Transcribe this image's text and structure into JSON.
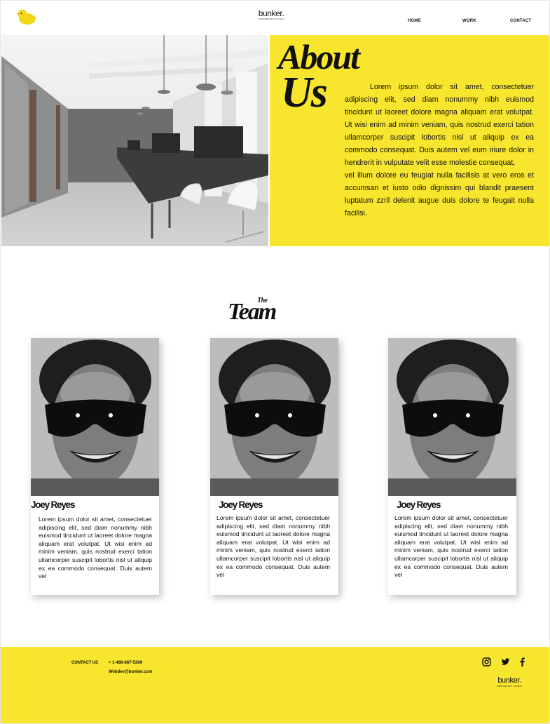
{
  "header": {
    "brand_name": "bunker.",
    "brand_tagline": "WEB DESIGN STUDIO",
    "nav": [
      "HOME",
      "WORK",
      "CONTACT"
    ]
  },
  "about": {
    "title_line1": "About",
    "title_line2": "Us",
    "paragraphs": [
      "Lorem ipsum dolor sit amet, consectetuer adipiscing elit, sed diam nonummy nibh euismod tincidunt ut laoreet dolore magna aliquam erat volutpat. Ut wisi enim ad minim veniam, quis nostrud exerci tation ullamcorper suscipit lobortis nisl ut aliquip ex ea commodo consequat. Duis autem vel eum iriure dolor in hendrerit in vulputate velit esse molestie consequat,",
      "vel illum dolore eu feugiat nulla facilisis at vero eros et accumsan et iusto odio dignissim qui blandit praesent luptatum zzril delenit augue duis dolore te feugait nulla facilisi."
    ]
  },
  "team": {
    "title_small": "The",
    "title_large": "Team",
    "members": [
      {
        "name": "Joey Reyes",
        "bio": "Lorem ipsum dolor sit amet, consectetuer adipiscing elit, sed diam nonummy nibh euismod tincidunt ut laoreet dolore magna aliquam erat volutpat. Ut wisi enim ad minim veniam, quis nostrud exerci tation ullamcorper suscipit lobortis nisl ut aliquip ex ea commodo consequat. Duis autem vel"
      },
      {
        "name": "Joey Reyes",
        "bio": "Lorem ipsum dolor sit amet, consectetuer adipiscing elit, sed diam nonummy nibh euismod tincidunt ut laoreet dolore magna aliquam erat volutpat. Ut wisi enim ad minim veniam, quis nostrud exerci tation ullamcorper suscipit lobortis nisl ut aliquip ex ea commodo consequat. Duis autem vel"
      },
      {
        "name": "Joey Reyes",
        "bio": "Lorem ipsum dolor sit amet, consectetuer adipiscing elit, sed diam nonummy nibh euismod tincidunt ut laoreet dolore magna aliquam erat volutpat. Ut wisi enim ad minim veniam, quis nostrud exerci tation ullamcorper suscipit lobortis nisl ut aliquip ex ea commodo consequat. Duis autem vel"
      }
    ]
  },
  "footer": {
    "contact_label": "CONTACT US",
    "phone": "+ 1-480-867-5309",
    "email": "Webdev@bunker.com",
    "social_icons": [
      "instagram-icon",
      "twitter-icon",
      "facebook-icon"
    ],
    "brand_name": "bunker.",
    "brand_tagline": "WEB DESIGN STUDIO"
  },
  "colors": {
    "accent_yellow": "#f8e52d",
    "text": "#111111",
    "background": "#ffffff"
  }
}
